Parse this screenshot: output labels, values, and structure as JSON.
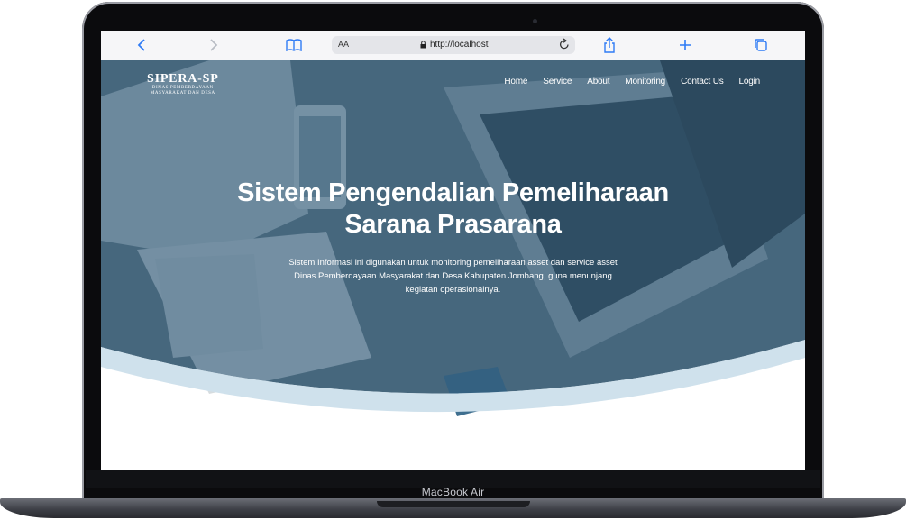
{
  "device": {
    "brand_label": "MacBook Air"
  },
  "browser": {
    "url": "http://localhost",
    "text_size_label": "AA",
    "icons": [
      "chevron-left-icon",
      "chevron-right-icon",
      "book-icon",
      "lock-icon",
      "reload-icon",
      "share-icon",
      "plus-icon",
      "tabs-icon"
    ]
  },
  "site": {
    "logo": {
      "title": "SIPERA-SP",
      "subtitle_line1": "DINAS PEMBERDAYAAN",
      "subtitle_line2": "MASYARAKAT DAN DESA"
    },
    "nav": [
      "Home",
      "Service",
      "About",
      "Monitoring",
      "Contact Us",
      "Login"
    ],
    "hero": {
      "title_line1": "Sistem Pengendalian Pemeliharaan",
      "title_line2": "Sarana Prasarana",
      "description": "Sistem Informasi ini digunakan untuk monitoring pemeliharaan asset dan service asset Dinas Pemberdayaan Masyarakat dan Desa Kabupaten Jombang, guna menunjang kegiatan operasionalnya."
    }
  },
  "colors": {
    "overlay": "#2d5877",
    "accent_blue": "#2f7bf5",
    "wave": "#cfe1ec"
  }
}
